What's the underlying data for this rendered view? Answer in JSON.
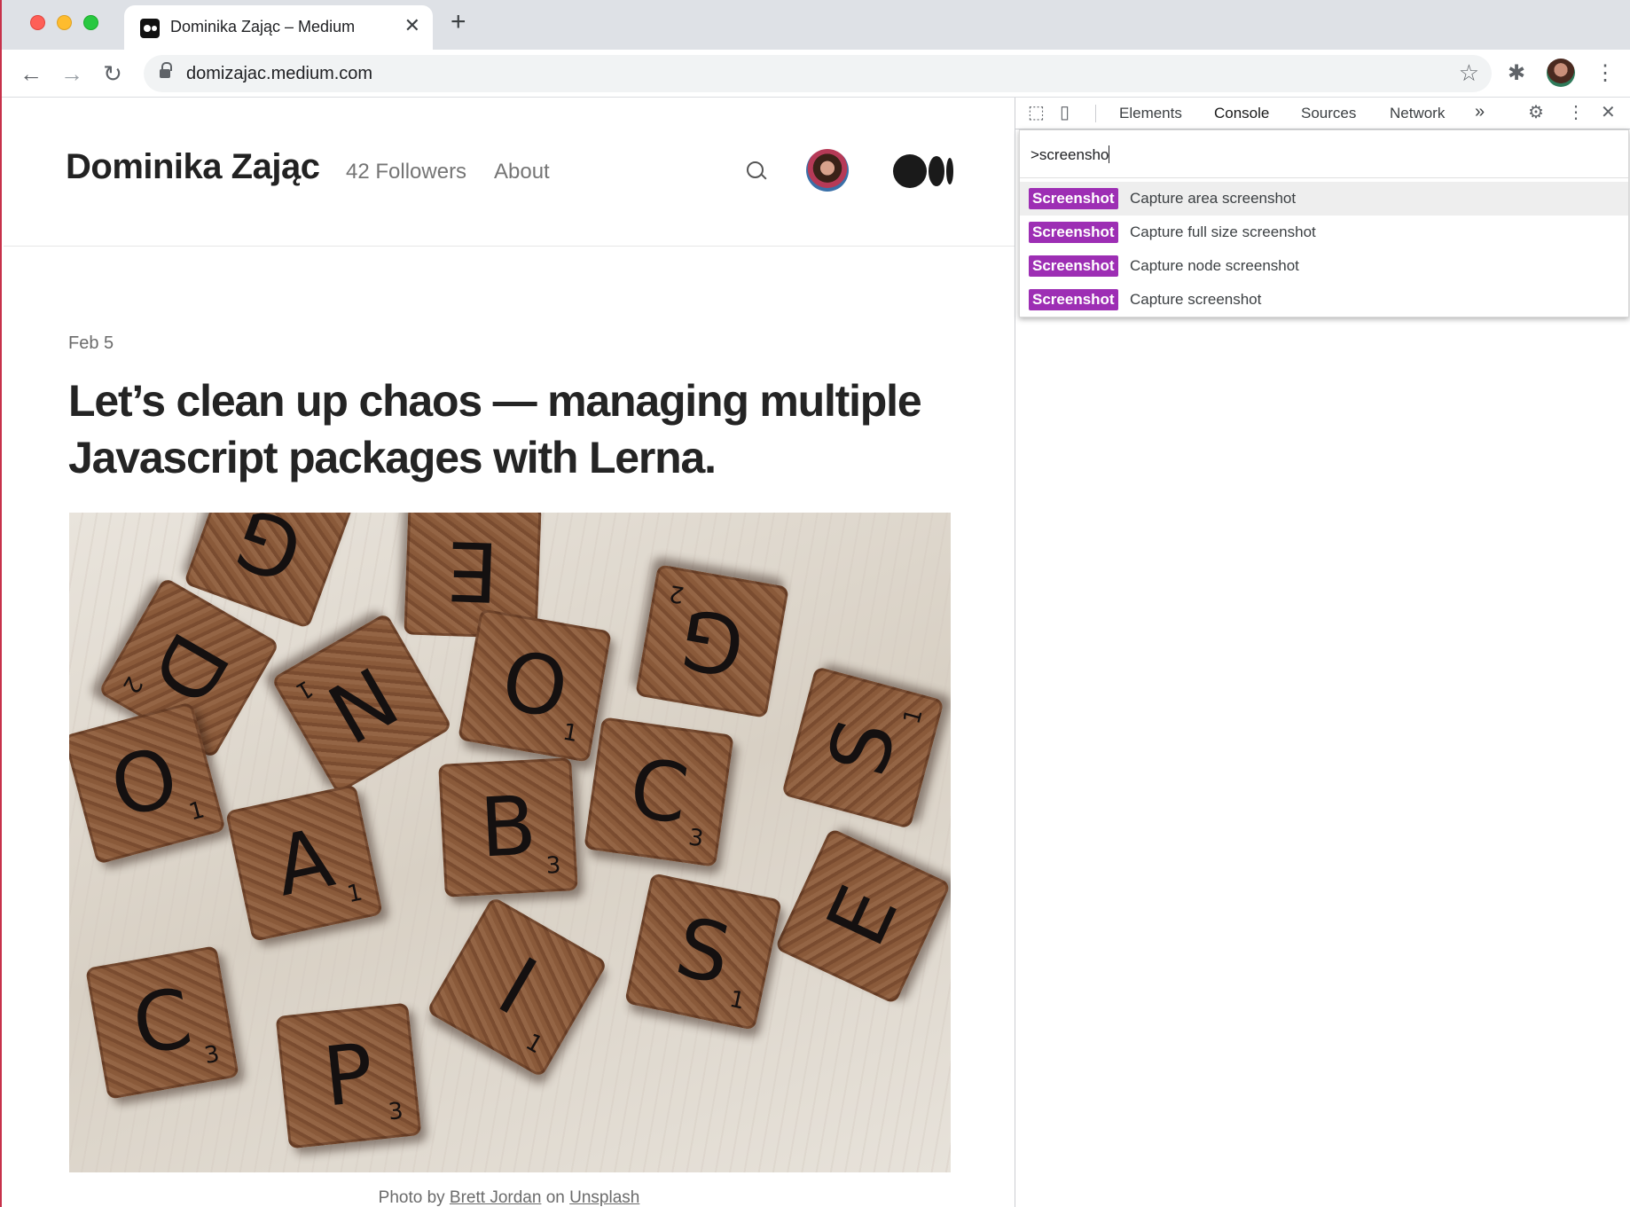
{
  "browser": {
    "tab_title": "Dominika Zając – Medium",
    "tab_close": "✕",
    "new_tab": "+",
    "url": "domizajac.medium.com",
    "back": "←",
    "forward": "→",
    "reload": "↻",
    "star": "☆",
    "menu": "⋮",
    "extensions": "✱"
  },
  "page": {
    "brand": "Dominika Zając",
    "followers": "42 Followers",
    "about": "About",
    "date": "Feb 5",
    "headline": "Let’s clean up chaos — managing multiple Javascript packages with Lerna.",
    "caption": {
      "prefix": "Photo by ",
      "author": "Brett Jordan",
      "middle": " on ",
      "source": "Unsplash"
    }
  },
  "devtools": {
    "tabs": [
      "Elements",
      "Console",
      "Sources",
      "Network"
    ],
    "active_tab": "Console",
    "more": "»",
    "settings": "⚙",
    "menu": "⋮",
    "close": "✕",
    "command_input": ">screensho",
    "commands": [
      {
        "badge": "Screenshot",
        "label": "Capture area screenshot",
        "selected": true
      },
      {
        "badge": "Screenshot",
        "label": "Capture full size screenshot",
        "selected": false
      },
      {
        "badge": "Screenshot",
        "label": "Capture node screenshot",
        "selected": false
      },
      {
        "badge": "Screenshot",
        "label": "Capture screenshot",
        "selected": false
      }
    ],
    "badge_color": "#9d2eb4"
  },
  "photo_tiles": [
    {
      "letter": "G",
      "num": ""
    },
    {
      "letter": "E",
      "num": ""
    },
    {
      "letter": "D",
      "num": "2"
    },
    {
      "letter": "N",
      "num": "1"
    },
    {
      "letter": "O",
      "num": "1"
    },
    {
      "letter": "G",
      "num": "2"
    },
    {
      "letter": "O",
      "num": "1"
    },
    {
      "letter": "C",
      "num": "3"
    },
    {
      "letter": "S",
      "num": "1"
    },
    {
      "letter": "A",
      "num": "1"
    },
    {
      "letter": "B",
      "num": "3"
    },
    {
      "letter": "E",
      "num": ""
    },
    {
      "letter": "C",
      "num": "3"
    },
    {
      "letter": "P",
      "num": "3"
    },
    {
      "letter": "I",
      "num": "1"
    },
    {
      "letter": "S",
      "num": "1"
    }
  ]
}
